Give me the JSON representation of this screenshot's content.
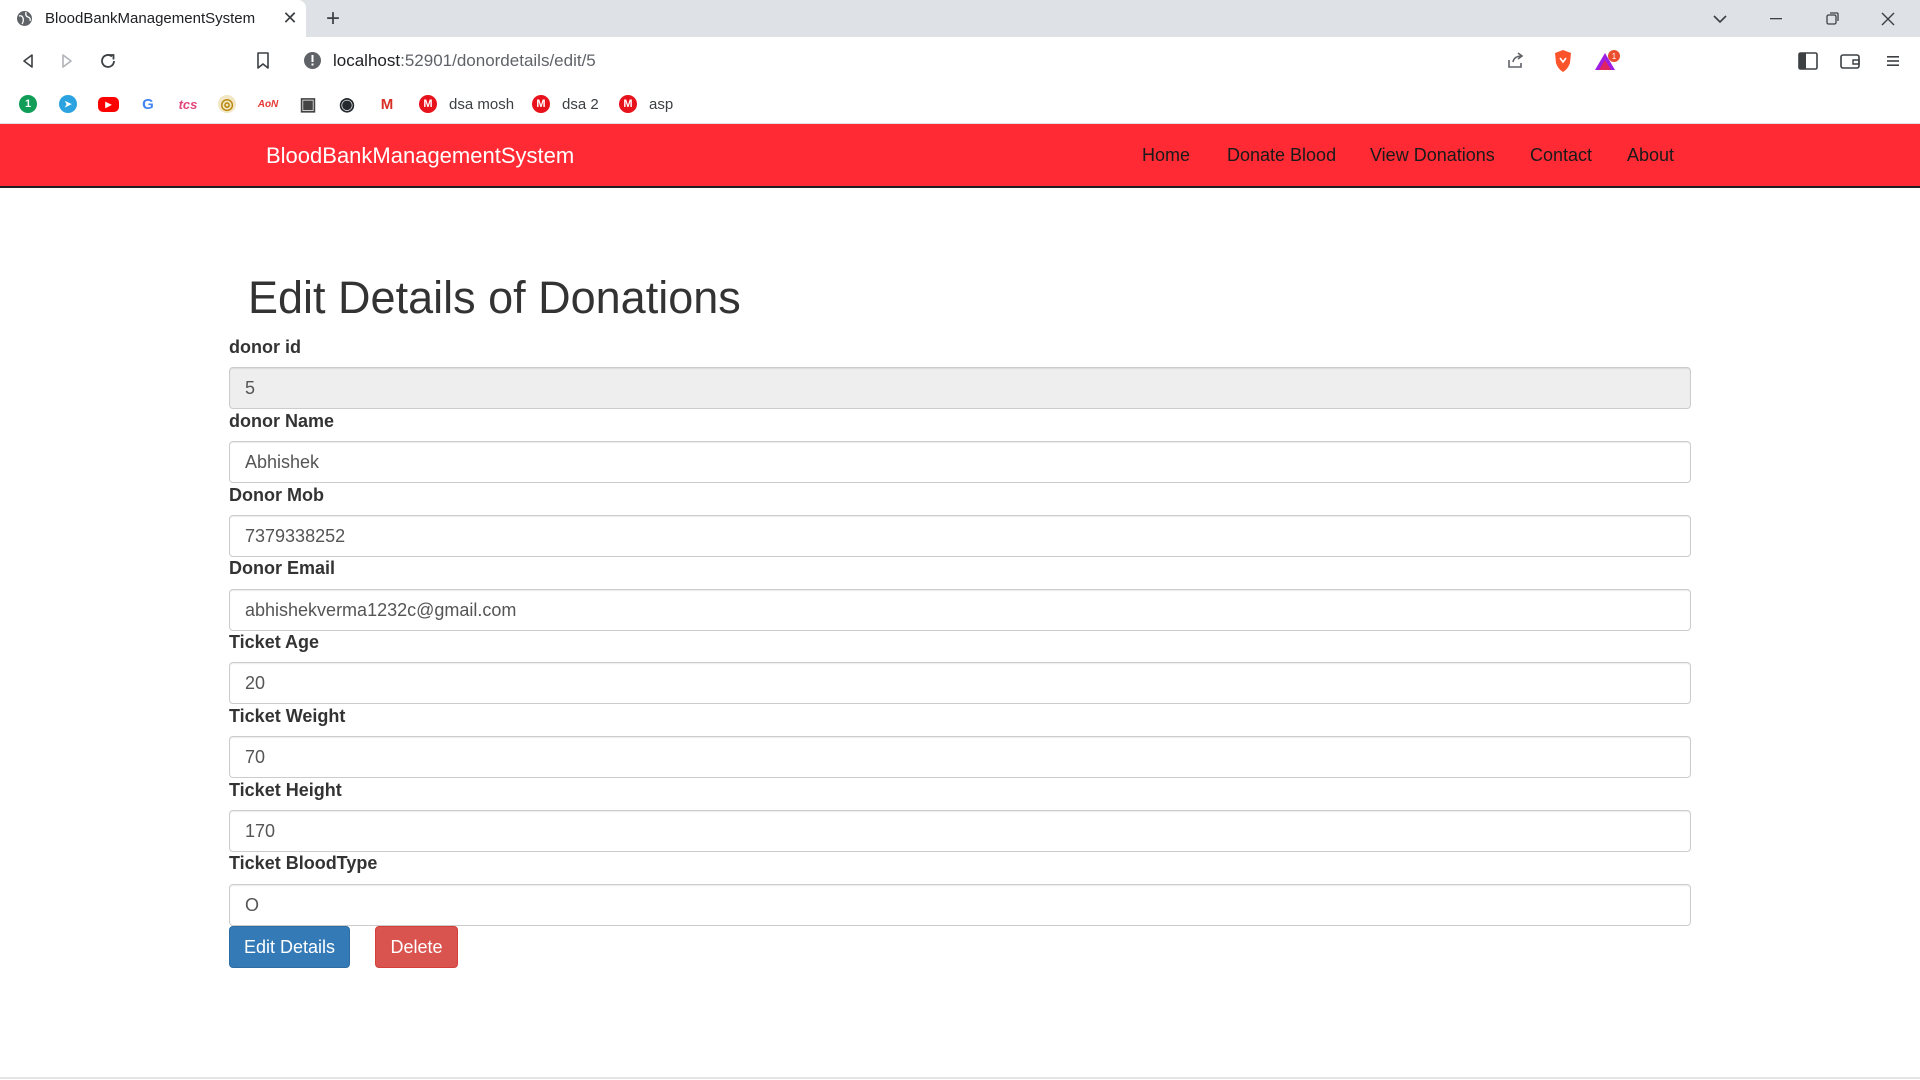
{
  "browser": {
    "tab_title": "BloodBankManagementSystem",
    "tab_close": "✕",
    "new_tab": "+",
    "url_host": "localhost",
    "url_rest": ":52901/donordetails/edit/5",
    "bookmarks": [
      {
        "icon": "1",
        "color": "#0f9d58",
        "label": ""
      },
      {
        "icon": "➤",
        "color": "#2aa3e0",
        "label": ""
      },
      {
        "icon": "▶",
        "color": "#ff0000",
        "label": ""
      },
      {
        "icon": "G",
        "color": "#4285f4",
        "label": ""
      },
      {
        "icon": "tcs",
        "color": "#e0457b",
        "label": ""
      },
      {
        "icon": "◎",
        "color": "#b8860b",
        "label": ""
      },
      {
        "icon": "AoN",
        "color": "#e53935",
        "label": ""
      },
      {
        "icon": "▣",
        "color": "#444444",
        "label": ""
      },
      {
        "icon": "◉",
        "color": "#24292e",
        "label": ""
      },
      {
        "icon": "M",
        "color": "#d93025",
        "label": ""
      },
      {
        "icon": "M",
        "color": "#e8121c",
        "label": "dsa mosh"
      },
      {
        "icon": "M",
        "color": "#e8121c",
        "label": "dsa 2"
      },
      {
        "icon": "M",
        "color": "#e8121c",
        "label": "asp"
      }
    ]
  },
  "navbar": {
    "brand": "BloodBankManagementSystem",
    "links": [
      "Home",
      "Donate Blood",
      "View Donations",
      "Contact",
      "About"
    ]
  },
  "page": {
    "title": "Edit Details of Donations",
    "fields": [
      {
        "label": "donor id",
        "value": "5"
      },
      {
        "label": "donor Name",
        "value": "Abhishek"
      },
      {
        "label": "Donor Mob",
        "value": "7379338252"
      },
      {
        "label": "Donor Email",
        "value": "abhishekverma1232c@gmail.com"
      },
      {
        "label": "Ticket Age",
        "value": "20"
      },
      {
        "label": "Ticket Weight",
        "value": "70"
      },
      {
        "label": "Ticket Height",
        "value": "170"
      },
      {
        "label": "Ticket BloodType",
        "value": "O"
      }
    ],
    "edit_button": "Edit Details",
    "delete_button": "Delete"
  },
  "colors": {
    "navbar": "#ff2a33",
    "primary": "#337ab7",
    "danger": "#d9534f"
  }
}
